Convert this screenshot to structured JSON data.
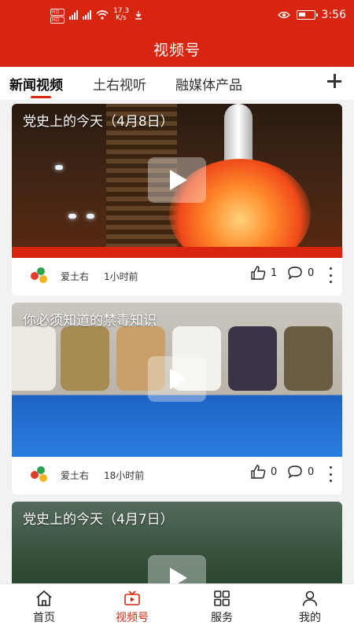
{
  "status_bar": {
    "speed_value": "17.3",
    "speed_unit": "K/s",
    "time": "3:56"
  },
  "header": {
    "title": "视频号"
  },
  "tabs": [
    {
      "label": "新闻视频",
      "active": true
    },
    {
      "label": "土右视听",
      "active": false
    },
    {
      "label": "融媒体产品",
      "active": false
    }
  ],
  "feed": [
    {
      "title": "党史上的今天（4月8日）",
      "author": "爱土右",
      "time_ago": "1小时前",
      "likes": "1",
      "comments": "0"
    },
    {
      "title": "你必须知道的禁毒知识",
      "author": "爱土右",
      "time_ago": "18小时前",
      "likes": "0",
      "comments": "0"
    },
    {
      "title": "党史上的今天（4月7日）"
    }
  ],
  "bottom_nav": [
    {
      "label": "首页",
      "icon": "home-icon",
      "active": false
    },
    {
      "label": "视频号",
      "icon": "video-icon",
      "active": true
    },
    {
      "label": "服务",
      "icon": "grid-icon",
      "active": false
    },
    {
      "label": "我的",
      "icon": "user-icon",
      "active": false
    }
  ],
  "colors": {
    "accent": "#d7250f",
    "text": "#222222"
  }
}
